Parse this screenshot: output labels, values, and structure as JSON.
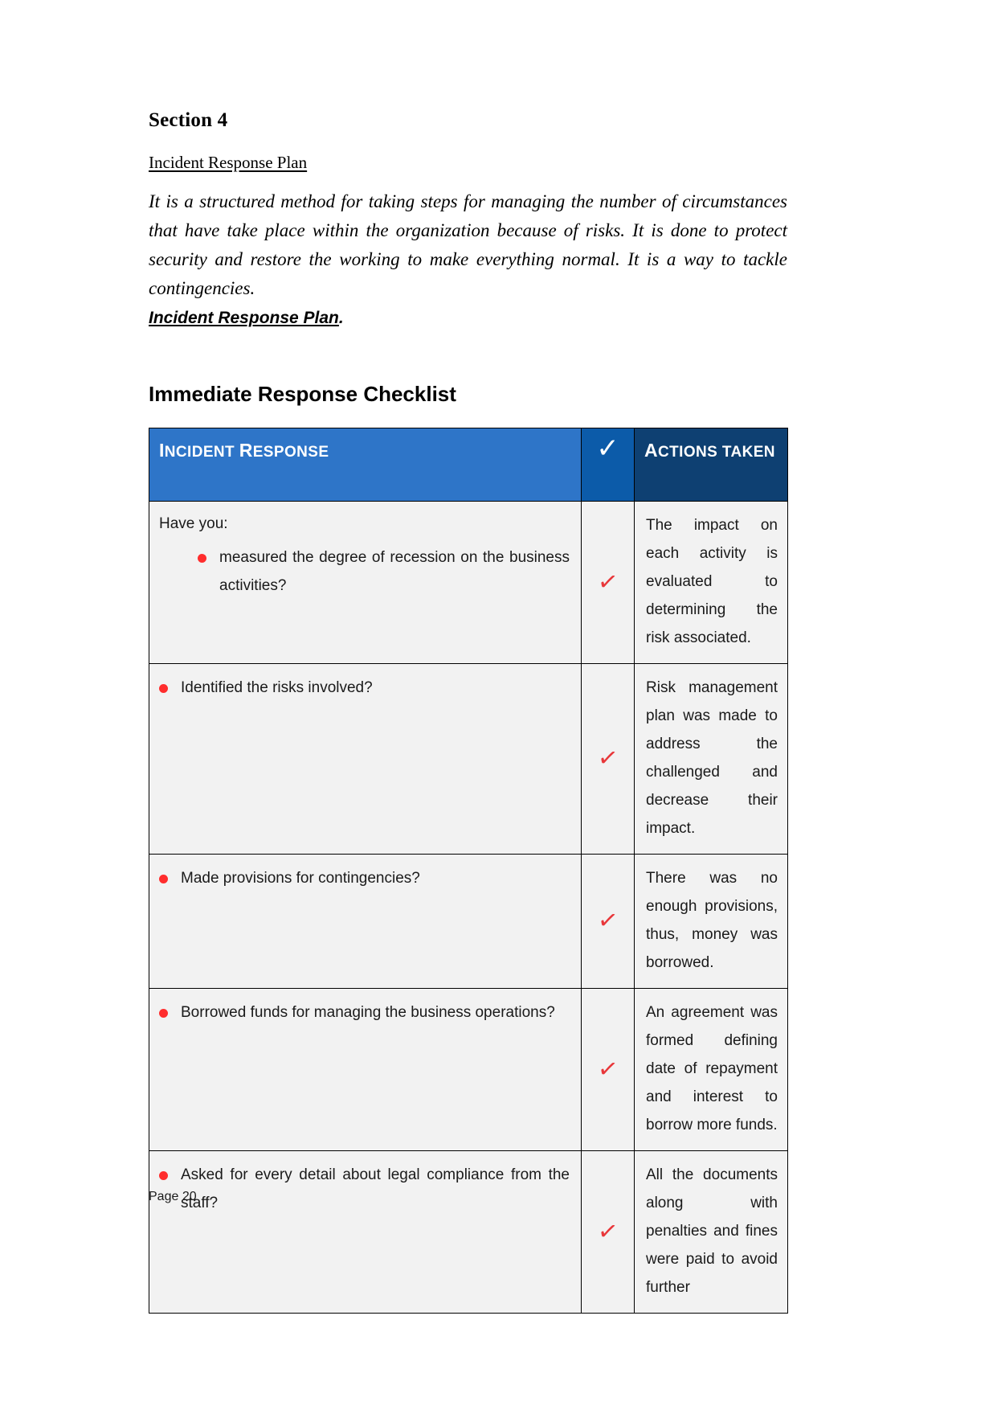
{
  "document": {
    "section_title": "Section 4",
    "subheading": "Incident Response Plan",
    "intro_paragraph": "It is a structured method for taking steps for managing the number of circumstances that have take place within the organization because of risks. It is done to protect security and restore the working to make everything normal. It is a way to tackle contingencies.",
    "intro_emphasis": "Incident Response Plan",
    "intro_emphasis_period": ".",
    "checklist_heading": "Immediate Response Checklist",
    "footer_page": "Page 20"
  },
  "table": {
    "headers": {
      "incident_response": "Incident Response",
      "check_icon": "check-icon",
      "check_glyph": "✓",
      "actions_taken": "Actions taken"
    },
    "colors": {
      "header_incident_bg": "#2E75C8",
      "header_check_bg": "#0C5BA9",
      "header_actions_bg": "#0E4072",
      "cell_bg": "#F2F2F2",
      "bullet_red": "#FF2D2D",
      "check_red": "#E8373A",
      "border": "#000000"
    },
    "rows": [
      {
        "lead_in": "Have you:",
        "question": "measured the degree of recession on the business activities?",
        "checked": true,
        "check_glyph": "✓",
        "action": "The impact on each activity is evaluated to determining the risk associated."
      },
      {
        "lead_in": "",
        "question": "Identified the risks involved?",
        "checked": true,
        "check_glyph": "✓",
        "action": "Risk management plan was made to address the challenged and decrease their impact."
      },
      {
        "lead_in": "",
        "question": "Made provisions for contingencies?",
        "checked": true,
        "check_glyph": "✓",
        "action": "There was no enough provisions, thus, money was borrowed."
      },
      {
        "lead_in": "",
        "question": "Borrowed funds for managing the business operations?",
        "checked": true,
        "check_glyph": "✓",
        "action": "An agreement was formed defining date of repayment and interest to borrow more funds."
      },
      {
        "lead_in": "",
        "question": "Asked for every detail about legal compliance from the staff?",
        "checked": true,
        "check_glyph": "✓",
        "action": "All the documents along with penalties and fines were paid to avoid further"
      }
    ]
  }
}
